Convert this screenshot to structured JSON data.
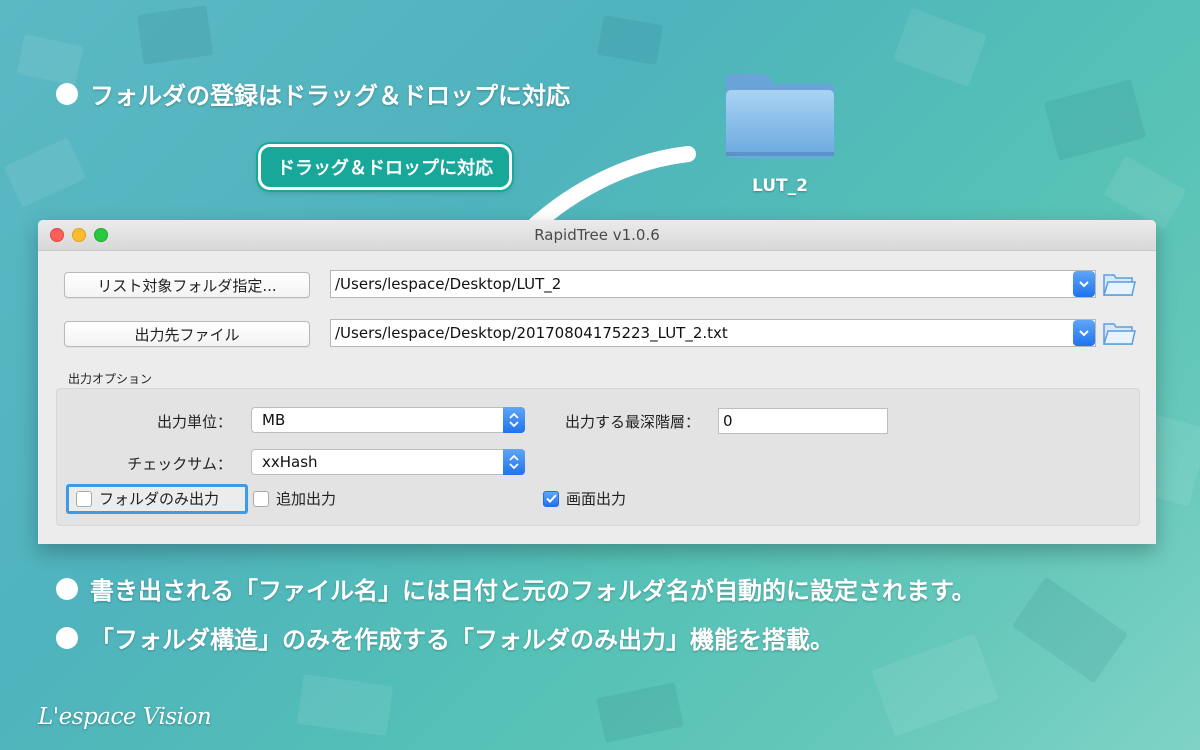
{
  "headline": "フォルダの登録はドラッグ＆ドロップに対応",
  "badge": "ドラッグ＆ドロップに対応",
  "folder_icon": {
    "icon": "folder-icon",
    "label": "LUT_2",
    "color": "#7fb5e6"
  },
  "window": {
    "title": "RapidTree v1.0.6",
    "source": {
      "button_label": "リスト対象フォルダ指定...",
      "path_value": "/Users/lespace/Desktop/LUT_2"
    },
    "output": {
      "button_label": "出力先ファイル",
      "path_value": "/Users/lespace/Desktop/20170804175223_LUT_2.txt"
    },
    "options": {
      "group_label": "出力オプション",
      "unit_label": "出力単位：",
      "unit_value": "MB",
      "depth_label": "出力する最深階層：",
      "depth_value": "0",
      "checksum_label": "チェックサム：",
      "checksum_value": "xxHash",
      "folder_only_label": "フォルダのみ出力",
      "folder_only_checked": false,
      "append_label": "追加出力",
      "append_checked": false,
      "screen_label": "画面出力",
      "screen_checked": true
    }
  },
  "notes": [
    "書き出される「ファイル名」には日付と元のフォルダ名が自動的に設定されます。",
    "「フォルダ構造」のみを作成する「フォルダのみ出力」機能を搭載。"
  ],
  "brand": "L'espace Vision",
  "colors": {
    "accent": "#1f73ec",
    "badge": "#17a89a",
    "background": "#54b9c0"
  }
}
